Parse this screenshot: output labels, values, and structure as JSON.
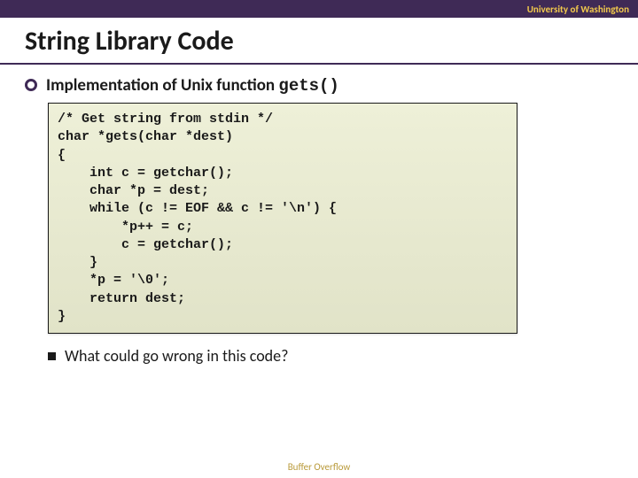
{
  "header": {
    "institution": "University of Washington"
  },
  "title": "String Library Code",
  "bullets": {
    "main": {
      "text_prefix": "Implementation of Unix function ",
      "code_token": "gets()"
    },
    "sub": {
      "text": "What could go wrong in this code?"
    }
  },
  "code_block": "/* Get string from stdin */\nchar *gets(char *dest)\n{\n    int c = getchar();\n    char *p = dest;\n    while (c != EOF && c != '\\n') {\n        *p++ = c;\n        c = getchar();\n    }\n    *p = '\\0';\n    return dest;\n}",
  "footer": "Buffer Overflow"
}
